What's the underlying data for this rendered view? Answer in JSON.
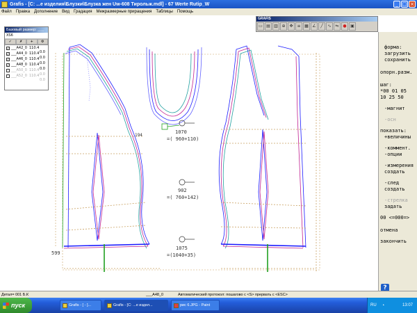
{
  "window": {
    "title": "Grafis - [C: ...е изделия\\Блузки\\Блузка жен Uw-608 Тирольж.mdl] - 67 Werte Rutip_W",
    "buttons": [
      "_",
      "□",
      "×"
    ]
  },
  "menu": {
    "items": [
      "Файл",
      "Правка",
      "Дополнение",
      "Вид",
      "Градация",
      "Межразмерные приращения",
      "Таблицы",
      "Помощь"
    ]
  },
  "toolbar": {
    "title": "GRAFIS",
    "icons": [
      "open-icon",
      "save-icon",
      "print-icon",
      "zoom-icon",
      "pan-icon",
      "measure-icon",
      "grid-icon",
      "angle-icon",
      "line-icon",
      "curve-icon",
      "mirror-icon",
      "stop-icon",
      "exit-icon"
    ]
  },
  "size_panel": {
    "title": "Базовый размер: ___",
    "base": "XS6",
    "rows": [
      {
        "checked": true,
        "name": "___A42_0",
        "v1": "110.4",
        "v2": "0.0",
        "dim": false
      },
      {
        "checked": true,
        "name": "___A44_0",
        "v1": "110.4",
        "v2": "0.0",
        "dim": false
      },
      {
        "checked": true,
        "name": "___A46_0",
        "v1": "110.4",
        "v2": "0.0",
        "dim": false
      },
      {
        "checked": true,
        "name": "___A48_0",
        "v1": "110.4",
        "v2": "0.0",
        "dim": false
      },
      {
        "checked": false,
        "name": "___A50_0",
        "v1": "110.4",
        "v2": "0.0",
        "dim": true
      },
      {
        "checked": false,
        "name": "___A52_0",
        "v1": "110.4",
        "v2": "0.0",
        "dim": true
      }
    ]
  },
  "drawing": {
    "annotations": [
      "1070",
      "=( 960+110)",
      "902",
      "=( 760+142)",
      "1075",
      "=(1040+35)",
      "599",
      "194"
    ]
  },
  "right_panel": {
    "form": "форма:",
    "load": "загрузить",
    "save": "сохранить",
    "base_size": "опорн.разм.",
    "step": "шаг:",
    "step_row1": "*00  01  05",
    "step_row2": " 10  25  50",
    "magnet": "-магнит",
    "snap": "-осн",
    "show": "показать:",
    "values": "+величины",
    "comments_1": "-коммент.",
    "comments_2": "-опции",
    "measure": "-измерения",
    "create1": "создать",
    "trace": "-след",
    "create2": "создать",
    "arrow": "-стрелка",
    "set": "задать",
    "range": "00 <=000=>",
    "cancel": "отмена",
    "finish": "закончить"
  },
  "status": {
    "detail": "Детал= 001 Б.К",
    "size": "___A48_0",
    "protocol": "Автоматический протокол: пошагово с <S> прервать с <ESC>"
  },
  "taskbar": {
    "start": "пуск",
    "tasks": [
      "Grafis - [ - ]...",
      "Grafis - [C: ...е издел...",
      "рис 6.JPG - Paint"
    ],
    "lang": "RU",
    "time": "13:07"
  }
}
